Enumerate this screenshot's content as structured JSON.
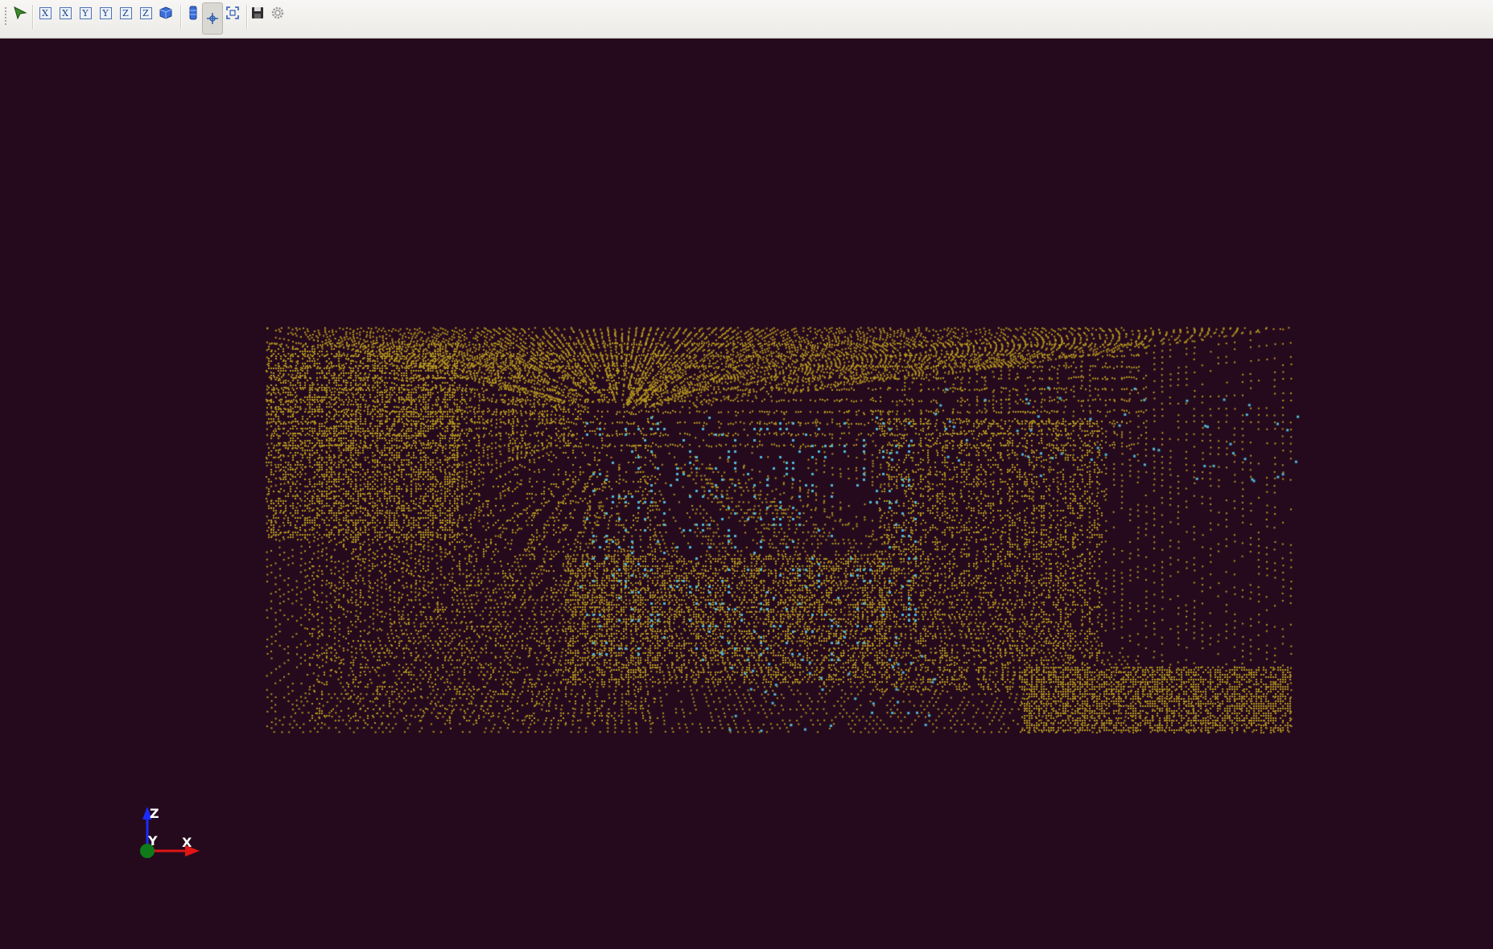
{
  "toolbar": {
    "buttons": [
      {
        "name": "pick-point-icon",
        "glyph": ""
      },
      {
        "name": "view-x-positive-button",
        "glyph": "X"
      },
      {
        "name": "view-x-negative-button",
        "glyph": "X"
      },
      {
        "name": "view-y-positive-button",
        "glyph": "Y"
      },
      {
        "name": "view-y-negative-button",
        "glyph": "Y"
      },
      {
        "name": "view-z-positive-button",
        "glyph": "Z"
      },
      {
        "name": "view-z-negative-button",
        "glyph": "Z"
      },
      {
        "name": "view-isometric-button",
        "glyph": ""
      },
      {
        "name": "parallel-projection-icon",
        "glyph": ""
      },
      {
        "name": "rotate-center-icon",
        "glyph": ""
      },
      {
        "name": "zoom-fit-icon",
        "glyph": ""
      },
      {
        "name": "save-icon",
        "glyph": ""
      },
      {
        "name": "settings-icon",
        "glyph": ""
      }
    ]
  },
  "viewport": {
    "background_color": "#250a1e",
    "point_colors": {
      "occupied": "#b89a1e",
      "highlight": "#4fb8d6"
    }
  },
  "orientation_gizmo": {
    "z_label": "Z",
    "y_label": "Y",
    "x_label": "X",
    "z_color": "#1a2bff",
    "y_color": "#0f7a1a",
    "x_color": "#e01515"
  }
}
